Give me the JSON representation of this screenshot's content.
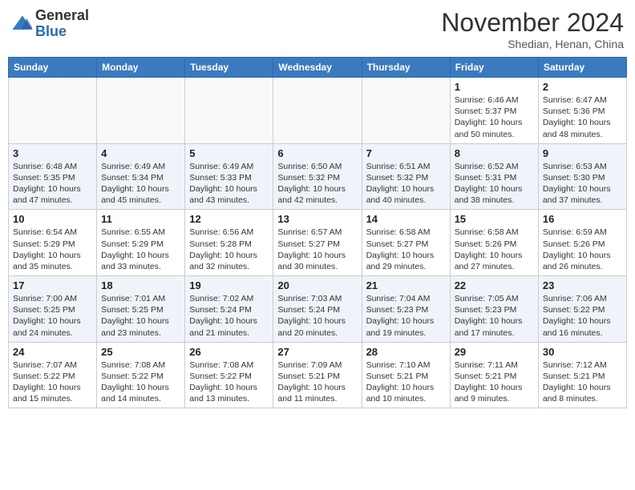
{
  "header": {
    "logo_general": "General",
    "logo_blue": "Blue",
    "month_year": "November 2024",
    "location": "Shedian, Henan, China"
  },
  "days_of_week": [
    "Sunday",
    "Monday",
    "Tuesday",
    "Wednesday",
    "Thursday",
    "Friday",
    "Saturday"
  ],
  "weeks": [
    [
      {
        "day": "",
        "info": ""
      },
      {
        "day": "",
        "info": ""
      },
      {
        "day": "",
        "info": ""
      },
      {
        "day": "",
        "info": ""
      },
      {
        "day": "",
        "info": ""
      },
      {
        "day": "1",
        "info": "Sunrise: 6:46 AM\nSunset: 5:37 PM\nDaylight: 10 hours\nand 50 minutes."
      },
      {
        "day": "2",
        "info": "Sunrise: 6:47 AM\nSunset: 5:36 PM\nDaylight: 10 hours\nand 48 minutes."
      }
    ],
    [
      {
        "day": "3",
        "info": "Sunrise: 6:48 AM\nSunset: 5:35 PM\nDaylight: 10 hours\nand 47 minutes."
      },
      {
        "day": "4",
        "info": "Sunrise: 6:49 AM\nSunset: 5:34 PM\nDaylight: 10 hours\nand 45 minutes."
      },
      {
        "day": "5",
        "info": "Sunrise: 6:49 AM\nSunset: 5:33 PM\nDaylight: 10 hours\nand 43 minutes."
      },
      {
        "day": "6",
        "info": "Sunrise: 6:50 AM\nSunset: 5:32 PM\nDaylight: 10 hours\nand 42 minutes."
      },
      {
        "day": "7",
        "info": "Sunrise: 6:51 AM\nSunset: 5:32 PM\nDaylight: 10 hours\nand 40 minutes."
      },
      {
        "day": "8",
        "info": "Sunrise: 6:52 AM\nSunset: 5:31 PM\nDaylight: 10 hours\nand 38 minutes."
      },
      {
        "day": "9",
        "info": "Sunrise: 6:53 AM\nSunset: 5:30 PM\nDaylight: 10 hours\nand 37 minutes."
      }
    ],
    [
      {
        "day": "10",
        "info": "Sunrise: 6:54 AM\nSunset: 5:29 PM\nDaylight: 10 hours\nand 35 minutes."
      },
      {
        "day": "11",
        "info": "Sunrise: 6:55 AM\nSunset: 5:29 PM\nDaylight: 10 hours\nand 33 minutes."
      },
      {
        "day": "12",
        "info": "Sunrise: 6:56 AM\nSunset: 5:28 PM\nDaylight: 10 hours\nand 32 minutes."
      },
      {
        "day": "13",
        "info": "Sunrise: 6:57 AM\nSunset: 5:27 PM\nDaylight: 10 hours\nand 30 minutes."
      },
      {
        "day": "14",
        "info": "Sunrise: 6:58 AM\nSunset: 5:27 PM\nDaylight: 10 hours\nand 29 minutes."
      },
      {
        "day": "15",
        "info": "Sunrise: 6:58 AM\nSunset: 5:26 PM\nDaylight: 10 hours\nand 27 minutes."
      },
      {
        "day": "16",
        "info": "Sunrise: 6:59 AM\nSunset: 5:26 PM\nDaylight: 10 hours\nand 26 minutes."
      }
    ],
    [
      {
        "day": "17",
        "info": "Sunrise: 7:00 AM\nSunset: 5:25 PM\nDaylight: 10 hours\nand 24 minutes."
      },
      {
        "day": "18",
        "info": "Sunrise: 7:01 AM\nSunset: 5:25 PM\nDaylight: 10 hours\nand 23 minutes."
      },
      {
        "day": "19",
        "info": "Sunrise: 7:02 AM\nSunset: 5:24 PM\nDaylight: 10 hours\nand 21 minutes."
      },
      {
        "day": "20",
        "info": "Sunrise: 7:03 AM\nSunset: 5:24 PM\nDaylight: 10 hours\nand 20 minutes."
      },
      {
        "day": "21",
        "info": "Sunrise: 7:04 AM\nSunset: 5:23 PM\nDaylight: 10 hours\nand 19 minutes."
      },
      {
        "day": "22",
        "info": "Sunrise: 7:05 AM\nSunset: 5:23 PM\nDaylight: 10 hours\nand 17 minutes."
      },
      {
        "day": "23",
        "info": "Sunrise: 7:06 AM\nSunset: 5:22 PM\nDaylight: 10 hours\nand 16 minutes."
      }
    ],
    [
      {
        "day": "24",
        "info": "Sunrise: 7:07 AM\nSunset: 5:22 PM\nDaylight: 10 hours\nand 15 minutes."
      },
      {
        "day": "25",
        "info": "Sunrise: 7:08 AM\nSunset: 5:22 PM\nDaylight: 10 hours\nand 14 minutes."
      },
      {
        "day": "26",
        "info": "Sunrise: 7:08 AM\nSunset: 5:22 PM\nDaylight: 10 hours\nand 13 minutes."
      },
      {
        "day": "27",
        "info": "Sunrise: 7:09 AM\nSunset: 5:21 PM\nDaylight: 10 hours\nand 11 minutes."
      },
      {
        "day": "28",
        "info": "Sunrise: 7:10 AM\nSunset: 5:21 PM\nDaylight: 10 hours\nand 10 minutes."
      },
      {
        "day": "29",
        "info": "Sunrise: 7:11 AM\nSunset: 5:21 PM\nDaylight: 10 hours\nand 9 minutes."
      },
      {
        "day": "30",
        "info": "Sunrise: 7:12 AM\nSunset: 5:21 PM\nDaylight: 10 hours\nand 8 minutes."
      }
    ]
  ]
}
